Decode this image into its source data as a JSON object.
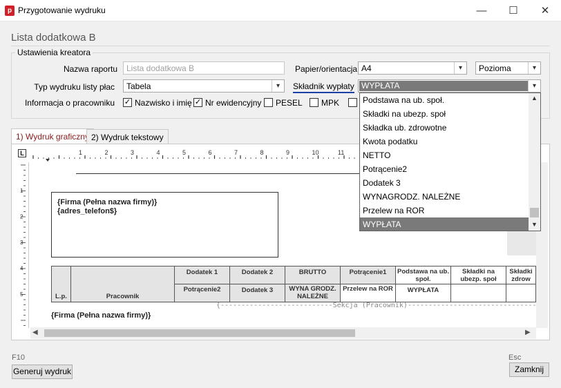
{
  "window": {
    "title": "Przygotowanie wydruku",
    "app_icon_letter": "p",
    "minimize": "—",
    "maximize": "☐",
    "close": "✕"
  },
  "page": {
    "heading": "Lista dodatkowa B",
    "group_title": "Ustawienia kreatora"
  },
  "form": {
    "report_name_label": "Nazwa raportu",
    "report_name_value": "Lista dodatkowa B",
    "print_type_label": "Typ wydruku listy płac",
    "print_type_value": "Tabela",
    "paper_label": "Papier/orientacja",
    "paper_value": "A4",
    "orientation_value": "Pozioma",
    "component_label": "Składnik wypłaty",
    "component_value": "WYPŁATA",
    "employee_info_label": "Informacja o pracowniku",
    "checkboxes": [
      {
        "label": "Nazwisko i imię",
        "checked": true
      },
      {
        "label": "Nr ewidencyjny",
        "checked": true
      },
      {
        "label": "PESEL",
        "checked": false
      },
      {
        "label": "MPK",
        "checked": false
      }
    ]
  },
  "tabs": [
    {
      "label": "1) Wydruk graficzny",
      "active": true
    },
    {
      "label": "2) Wydruk tekstowy",
      "active": false
    }
  ],
  "ruler": {
    "corner": "L",
    "top_numbers": [
      "1",
      "2",
      "3",
      "4",
      "5",
      "6",
      "7",
      "8",
      "9",
      "10",
      "11"
    ],
    "left_numbers": [
      "1",
      "2",
      "3",
      "4",
      "5"
    ]
  },
  "design": {
    "firm_box_line1": "{Firma (Pełna nazwa firmy)}",
    "firm_box_line2": "{adres_telefon$}",
    "table": {
      "lp": "L.p.",
      "pracownik": "Pracownik",
      "row1": [
        "Dodatek  1",
        "Dodatek  2",
        "BRUTTO",
        "Potrącenie1",
        "Podstawa na ub. społ.",
        "Składki na ubezp. społ",
        "Składki zdrow"
      ],
      "row2": [
        "Potrącenie2",
        "Dodatek  3",
        "WYNA GRODZ. NALEŻNE",
        "Przelew  na ROR",
        "WYPŁATA",
        "",
        ""
      ]
    },
    "section_label": "{---------------------------Sekcja (Pracownik)-------------------------------",
    "footer_firm": "{Firma (Pełna nazwa firmy)}"
  },
  "dropdown": {
    "items": [
      "Podstawa na ub. społ.",
      "Składki na ubezp. społ",
      "Składka ub. zdrowotne",
      "Kwota podatku",
      "NETTO",
      "Potrącenie2",
      "Dodatek   3",
      "WYNAGRODZ. NALEŻNE",
      "Przelew  na ROR",
      "WYPŁATA"
    ],
    "selected_index": 9
  },
  "bottom": {
    "generate_hotkey": "F10",
    "generate_label": "Generuj wydruk",
    "close_hotkey": "Esc",
    "close_label": "Zamknij"
  },
  "colors": {
    "accent_red": "#d0202a",
    "active_tab_text": "#8b1a1a",
    "selection_gray": "#7a7a7a"
  }
}
